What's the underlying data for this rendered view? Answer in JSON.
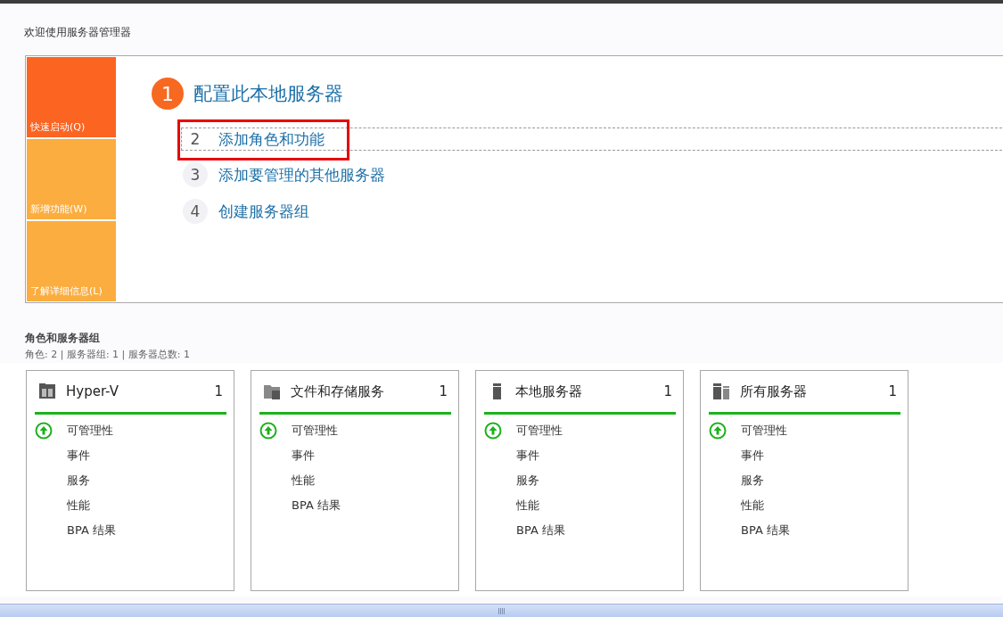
{
  "page_title": "欢迎使用服务器管理器",
  "quick_tiles": [
    {
      "label": "快速启动(Q)",
      "selected": true
    },
    {
      "label": "新增功能(W)",
      "selected": false
    },
    {
      "label": "了解详细信息(L)",
      "selected": false
    }
  ],
  "main_step": {
    "number": "1",
    "label": "配置此本地服务器"
  },
  "steps": [
    {
      "number": "2",
      "label": "添加角色和功能",
      "focused": true,
      "highlighted": true
    },
    {
      "number": "3",
      "label": "添加要管理的其他服务器",
      "focused": false,
      "highlighted": false
    },
    {
      "number": "4",
      "label": "创建服务器组",
      "focused": false,
      "highlighted": false
    }
  ],
  "section": {
    "title": "角色和服务器组",
    "summary": "角色: 2 | 服务器组: 1 | 服务器总数: 1"
  },
  "cards": [
    {
      "kind": "hyperv",
      "title": "Hyper-V",
      "count": "1",
      "items": [
        {
          "label": "可管理性",
          "status_ok": true
        },
        {
          "label": "事件",
          "status_ok": false
        },
        {
          "label": "服务",
          "status_ok": false
        },
        {
          "label": "性能",
          "status_ok": false
        },
        {
          "label": "BPA 结果",
          "status_ok": false
        }
      ]
    },
    {
      "kind": "files",
      "title": "文件和存储服务",
      "count": "1",
      "items": [
        {
          "label": "可管理性",
          "status_ok": true
        },
        {
          "label": "事件",
          "status_ok": false
        },
        {
          "label": "性能",
          "status_ok": false
        },
        {
          "label": "BPA 结果",
          "status_ok": false
        }
      ]
    },
    {
      "kind": "server",
      "title": "本地服务器",
      "count": "1",
      "items": [
        {
          "label": "可管理性",
          "status_ok": true
        },
        {
          "label": "事件",
          "status_ok": false
        },
        {
          "label": "服务",
          "status_ok": false
        },
        {
          "label": "性能",
          "status_ok": false
        },
        {
          "label": "BPA 结果",
          "status_ok": false
        }
      ]
    },
    {
      "kind": "servers",
      "title": "所有服务器",
      "count": "1",
      "items": [
        {
          "label": "可管理性",
          "status_ok": true
        },
        {
          "label": "事件",
          "status_ok": false
        },
        {
          "label": "服务",
          "status_ok": false
        },
        {
          "label": "性能",
          "status_ok": false
        },
        {
          "label": "BPA 结果",
          "status_ok": false
        }
      ]
    }
  ]
}
